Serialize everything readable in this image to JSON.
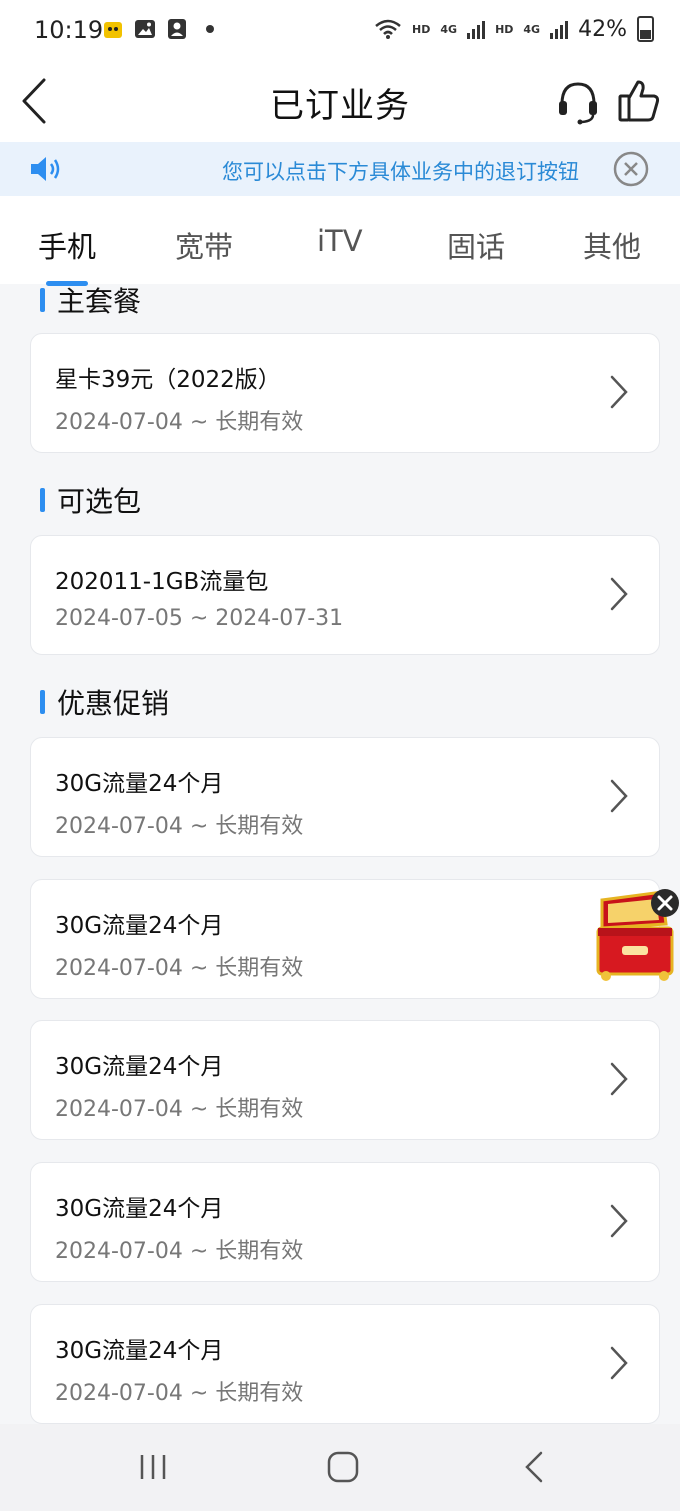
{
  "status_bar": {
    "time": "10:19",
    "signal_label_1": "HD",
    "signal_net_1": "4G",
    "signal_label_2": "HD",
    "signal_net_2": "4G",
    "battery": "42%"
  },
  "header": {
    "title": "已订业务",
    "icons": [
      "back-arrow-icon",
      "headset-icon",
      "thumbs-up-icon"
    ]
  },
  "notice": {
    "text": "您可以点击下方具体业务中的退订按钮",
    "icons": [
      "speaker-icon",
      "close-icon"
    ]
  },
  "tabs": [
    {
      "label": "手机",
      "active": true
    },
    {
      "label": "宽带",
      "active": false
    },
    {
      "label": "iTV",
      "active": false
    },
    {
      "label": "固话",
      "active": false
    },
    {
      "label": "其他",
      "active": false
    }
  ],
  "sections": {
    "main_package": {
      "title": "主套餐",
      "items": [
        {
          "name": "星卡39元（2022版）",
          "period": "2024-07-04 ~ 长期有效"
        }
      ]
    },
    "optional": {
      "title": "可选包",
      "items": [
        {
          "name": "202011-1GB流量包",
          "period": "2024-07-05 ~ 2024-07-31"
        }
      ]
    },
    "promotions": {
      "title": "优惠促销",
      "items": [
        {
          "name": "30G流量24个月",
          "period": "2024-07-04 ~ 长期有效"
        },
        {
          "name": "30G流量24个月",
          "period": "2024-07-04 ~ 长期有效"
        },
        {
          "name": "30G流量24个月",
          "period": "2024-07-04 ~ 长期有效"
        },
        {
          "name": "30G流量24个月",
          "period": "2024-07-04 ~ 长期有效"
        },
        {
          "name": "30G流量24个月",
          "period": "2024-07-04 ~ 长期有效"
        }
      ]
    }
  },
  "colors": {
    "accent": "#2d8ef0",
    "notice_bg": "#e9f2fc",
    "notice_text": "#2a8ad6"
  }
}
